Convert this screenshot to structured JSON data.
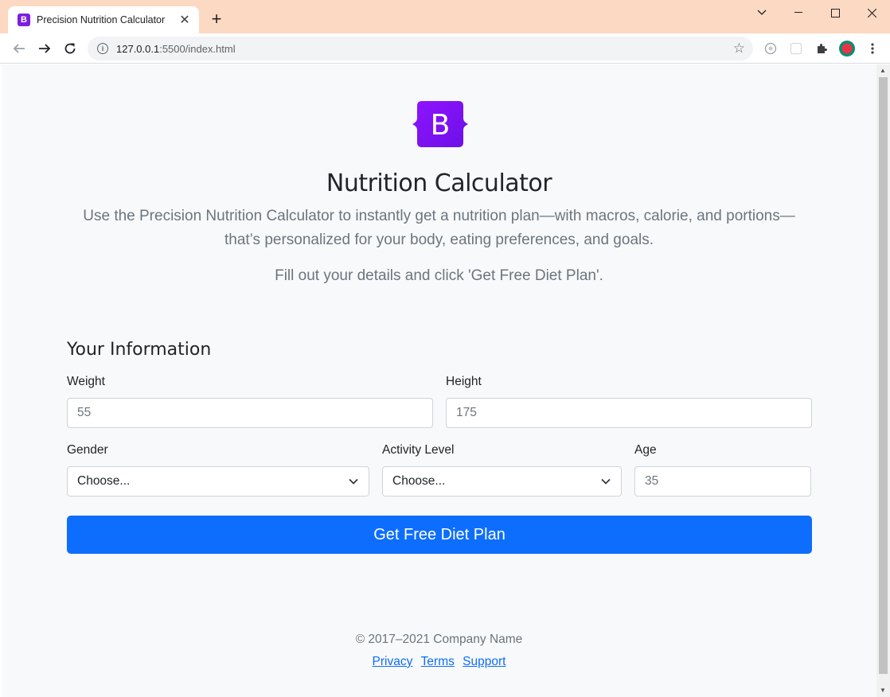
{
  "browser": {
    "tab_title": "Precision Nutrition Calculator",
    "tab_favicon_letter": "B",
    "url_host": "127.0.0.1",
    "url_rest": ":5500/index.html"
  },
  "page": {
    "logo_letter": "B",
    "title": "Nutrition Calculator",
    "lead": "Use the Precision Nutrition Calculator to instantly get a nutrition plan—with macros, calorie, and portions—that’s personalized for your body, eating preferences, and goals.",
    "instructions": "Fill out your details and click 'Get Free Diet Plan'."
  },
  "form": {
    "title": "Your Information",
    "weight": {
      "label": "Weight",
      "placeholder": "55"
    },
    "height": {
      "label": "Height",
      "placeholder": "175"
    },
    "gender": {
      "label": "Gender",
      "selected": "Choose..."
    },
    "activity": {
      "label": "Activity Level",
      "selected": "Choose..."
    },
    "age": {
      "label": "Age",
      "placeholder": "35"
    },
    "submit_label": "Get Free Diet Plan"
  },
  "footer": {
    "copyright": "© 2017–2021 Company Name",
    "links": [
      "Privacy",
      "Terms",
      "Support"
    ]
  },
  "colors": {
    "brand_purple": "#7b1fe0",
    "primary": "#0d6efd",
    "titlebar": "#fcd9c2"
  }
}
